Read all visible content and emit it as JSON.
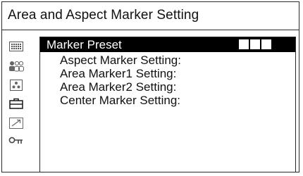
{
  "window": {
    "title": "Area and Aspect Marker Setting"
  },
  "sidebar": {
    "icons": [
      {
        "name": "menu-grid-icon"
      },
      {
        "name": "users-icon"
      },
      {
        "name": "image-settings-icon"
      },
      {
        "name": "briefcase-icon"
      },
      {
        "name": "trend-arrow-icon"
      },
      {
        "name": "key-icon"
      }
    ]
  },
  "menu": {
    "preset": {
      "label": "Marker Preset",
      "value_squares": 3
    },
    "items": [
      {
        "label": "Aspect Marker Setting:"
      },
      {
        "label": "Area Marker1 Setting:"
      },
      {
        "label": "Area Marker2 Setting:"
      },
      {
        "label": "Center Marker Setting:"
      }
    ]
  }
}
